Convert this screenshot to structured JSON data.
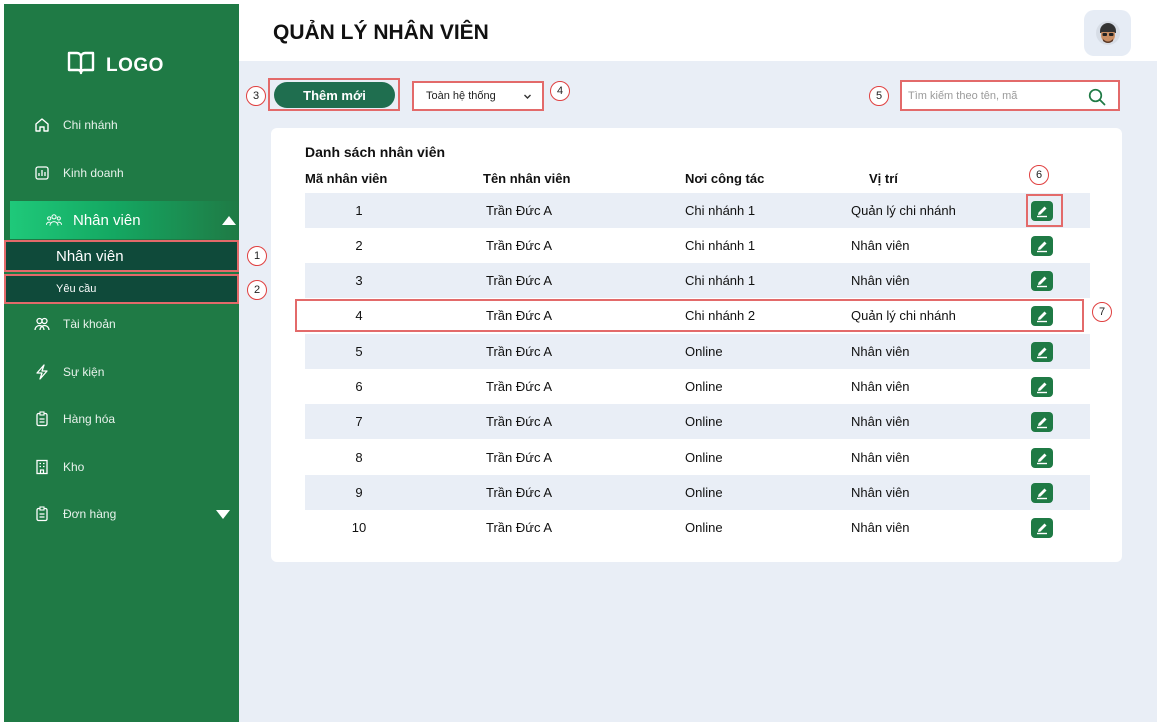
{
  "sidebar": {
    "logo_text": "LOGO",
    "items": [
      {
        "label": "Chi nhánh",
        "icon": "home-icon"
      },
      {
        "label": "Kinh doanh",
        "icon": "chart-icon"
      },
      {
        "label": "Nhân viên",
        "icon": "users-icon",
        "active": true
      },
      {
        "label": "Tài khoản",
        "icon": "user-group-icon"
      },
      {
        "label": "Sự kiện",
        "icon": "bolt-icon"
      },
      {
        "label": "Hàng hóa",
        "icon": "clipboard-icon"
      },
      {
        "label": "Kho",
        "icon": "building-icon"
      },
      {
        "label": "Đơn hàng",
        "icon": "clipboard-icon"
      }
    ],
    "subitems": [
      {
        "label": "Nhân viên"
      },
      {
        "label": "Yêu cầu"
      }
    ]
  },
  "header": {
    "title": "QUẢN LÝ NHÂN VIÊN"
  },
  "toolbar": {
    "add_label": "Thêm mới",
    "scope_value": "Toàn hệ thống",
    "search_placeholder": "Tìm kiếm theo tên, mã"
  },
  "table": {
    "title": "Danh sách nhân viên",
    "columns": [
      "Mã nhân viên",
      "Tên nhân viên",
      "Nơi công tác",
      "Vị trí"
    ],
    "rows": [
      [
        "1",
        "Trần Đức A",
        "Chi nhánh 1",
        "Quản lý chi nhánh"
      ],
      [
        "2",
        "Trần Đức A",
        "Chi nhánh 1",
        "Nhân viên"
      ],
      [
        "3",
        "Trần Đức A",
        "Chi nhánh 1",
        "Nhân viên"
      ],
      [
        "4",
        "Trần Đức A",
        "Chi nhánh 2",
        "Quản lý chi nhánh"
      ],
      [
        "5",
        "Trần Đức A",
        "Online",
        "Nhân viên"
      ],
      [
        "6",
        "Trần Đức A",
        "Online",
        "Nhân viên"
      ],
      [
        "7",
        "Trần Đức A",
        "Online",
        "Nhân viên"
      ],
      [
        "8",
        "Trần Đức A",
        "Online",
        "Nhân viên"
      ],
      [
        "9",
        "Trần Đức A",
        "Online",
        "Nhân viên"
      ],
      [
        "10",
        "Trần Đức A",
        "Online",
        "Nhân viên"
      ]
    ]
  },
  "annotations": [
    "1",
    "2",
    "3",
    "4",
    "5",
    "6",
    "7"
  ],
  "colors": {
    "sidebar": "#1f7a45",
    "active_gradient": "#1fc97a",
    "subitem": "#0f4a3a",
    "button": "#1f6e4f",
    "annotation": "#e36a6a",
    "row_alt": "#e9eef6"
  }
}
